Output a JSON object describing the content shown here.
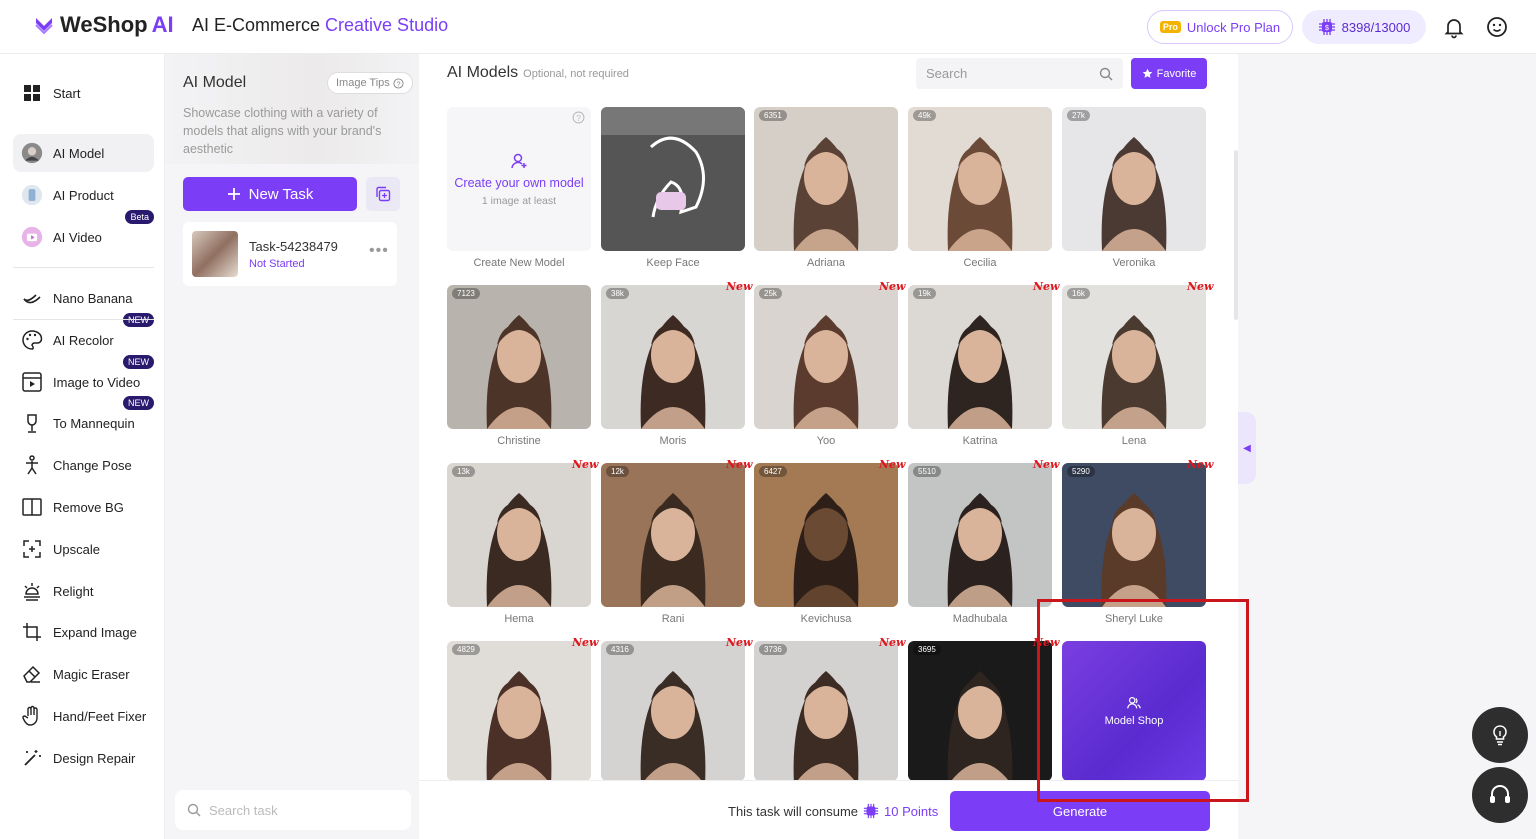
{
  "header": {
    "logo_text": "WeShop",
    "logo_ai": "AI",
    "title_prefix": "AI E-Commerce ",
    "title_accent": "Creative Studio",
    "pro_tag": "Pro",
    "unlock_label": "Unlock Pro Plan",
    "points": "8398/13000",
    "icons": [
      "bell-icon",
      "face-icon"
    ]
  },
  "sidebar": {
    "items": [
      {
        "label": "Start",
        "icon": "grid-icon"
      },
      {
        "label": "AI Model",
        "icon": "model-avatar-icon",
        "active": true
      },
      {
        "label": "AI Product",
        "icon": "product-icon"
      },
      {
        "label": "AI Video",
        "icon": "video-icon",
        "badge": "Beta"
      },
      {
        "label": "Nano Banana",
        "icon": "banana-icon"
      },
      {
        "label": "AI Recolor",
        "icon": "palette-icon",
        "badge": "NEW"
      },
      {
        "label": "Image to Video",
        "icon": "image-video-icon",
        "badge": "NEW"
      },
      {
        "label": "To Mannequin",
        "icon": "mannequin-icon",
        "badge": "NEW"
      },
      {
        "label": "Change Pose",
        "icon": "pose-icon"
      },
      {
        "label": "Remove BG",
        "icon": "remove-bg-icon"
      },
      {
        "label": "Upscale",
        "icon": "upscale-icon"
      },
      {
        "label": "Relight",
        "icon": "relight-icon"
      },
      {
        "label": "Expand Image",
        "icon": "crop-icon"
      },
      {
        "label": "Magic Eraser",
        "icon": "eraser-icon"
      },
      {
        "label": "Hand/Feet Fixer",
        "icon": "hand-icon"
      },
      {
        "label": "Design Repair",
        "icon": "wand-icon"
      }
    ]
  },
  "panel": {
    "title": "AI Model",
    "tips_label": "Image Tips",
    "description": "Showcase clothing with a variety of models that aligns with your brand's aesthetic",
    "new_task_label": "New Task",
    "task": {
      "name": "Task-54238479",
      "status": "Not Started"
    },
    "search_placeholder": "Search task"
  },
  "main": {
    "title": "AI Models",
    "subtitle": "Optional, not required",
    "search_placeholder": "Search",
    "favorite_label": "Favorite",
    "create_card": {
      "title": "Create your own model",
      "sub": "1 image at least",
      "name": "Create New Model"
    },
    "model_shop_label": "Model Shop",
    "new_tag": "New",
    "models": [
      {
        "name": "Keep Face",
        "count": "",
        "new": false,
        "colors": [
          "#6a6a6a",
          "#3f3f3f"
        ]
      },
      {
        "name": "Adriana",
        "count": "6351",
        "new": false,
        "colors": [
          "#d6cfc8",
          "#5a4236"
        ]
      },
      {
        "name": "Cecilia",
        "count": "49k",
        "new": false,
        "colors": [
          "#e2dbd4",
          "#6b4a37"
        ]
      },
      {
        "name": "Veronika",
        "count": "27k",
        "new": false,
        "colors": [
          "#e6e6e8",
          "#4a3a33"
        ]
      },
      {
        "name": "Christine",
        "count": "7123",
        "new": false,
        "colors": [
          "#b8b3ad",
          "#4c3428"
        ]
      },
      {
        "name": "Moris",
        "count": "38k",
        "new": true,
        "colors": [
          "#d8d6d3",
          "#3d2a22"
        ]
      },
      {
        "name": "Yoo",
        "count": "25k",
        "new": true,
        "colors": [
          "#d9d4cf",
          "#5b3b2e"
        ]
      },
      {
        "name": "Katrina",
        "count": "19k",
        "new": true,
        "colors": [
          "#dcd8d4",
          "#2e2420"
        ]
      },
      {
        "name": "Lena",
        "count": "16k",
        "new": true,
        "colors": [
          "#e3e1de",
          "#4a3a30"
        ]
      },
      {
        "name": "Hema",
        "count": "13k",
        "new": true,
        "colors": [
          "#d9d5d1",
          "#3b2a22"
        ]
      },
      {
        "name": "Rani",
        "count": "12k",
        "new": true,
        "colors": [
          "#9a7458",
          "#3a2a20"
        ]
      },
      {
        "name": "Kevichusa",
        "count": "6427",
        "new": true,
        "colors": [
          "#a47a55",
          "#2e2018"
        ]
      },
      {
        "name": "Madhubala",
        "count": "5510",
        "new": true,
        "colors": [
          "#c2c5c4",
          "#2b2220"
        ]
      },
      {
        "name": "Sheryl Luke",
        "count": "5290",
        "new": true,
        "colors": [
          "#3e4b63",
          "#5a3a28"
        ]
      },
      {
        "name": "",
        "count": "4829",
        "new": true,
        "colors": [
          "#e0ddd9",
          "#4a3026"
        ]
      },
      {
        "name": "",
        "count": "4316",
        "new": true,
        "colors": [
          "#d5d3d1",
          "#3a2d26"
        ]
      },
      {
        "name": "",
        "count": "3736",
        "new": true,
        "colors": [
          "#d3d2d0",
          "#3d2c24"
        ]
      },
      {
        "name": "",
        "count": "3695",
        "new": true,
        "colors": [
          "#1a1a1a",
          "#2e2420"
        ]
      }
    ]
  },
  "footer": {
    "consume_prefix": "This task will consume",
    "points_label": "10 Points",
    "generate_label": "Generate"
  },
  "colors": {
    "accent": "#7b3df5",
    "highlight": "#c9161d",
    "new_tag": "#e0161d"
  }
}
